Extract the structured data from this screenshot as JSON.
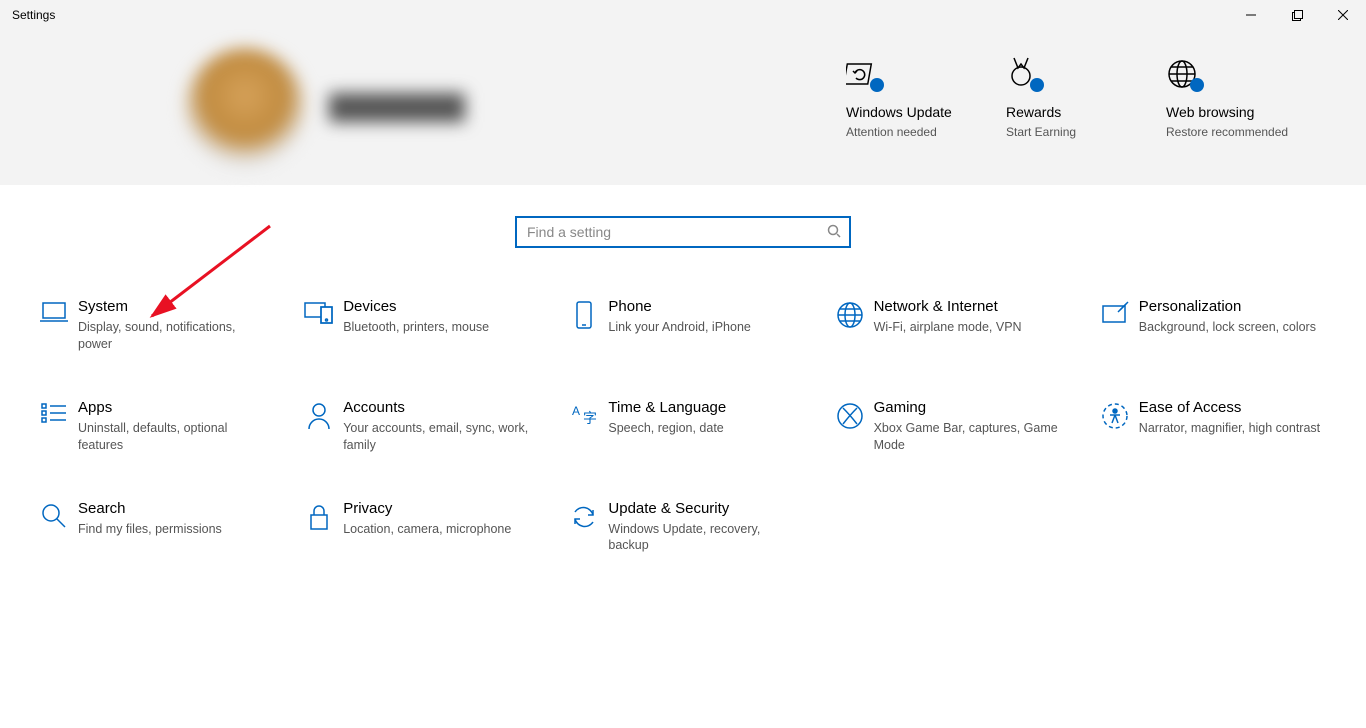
{
  "window": {
    "title": "Settings"
  },
  "search": {
    "placeholder": "Find a setting"
  },
  "header_tiles": [
    {
      "title": "Windows Update",
      "sub": "Attention needed"
    },
    {
      "title": "Rewards",
      "sub": "Start Earning"
    },
    {
      "title": "Web browsing",
      "sub": "Restore recommended"
    }
  ],
  "categories": [
    {
      "title": "System",
      "sub": "Display, sound, notifications, power"
    },
    {
      "title": "Devices",
      "sub": "Bluetooth, printers, mouse"
    },
    {
      "title": "Phone",
      "sub": "Link your Android, iPhone"
    },
    {
      "title": "Network & Internet",
      "sub": "Wi-Fi, airplane mode, VPN"
    },
    {
      "title": "Personalization",
      "sub": "Background, lock screen, colors"
    },
    {
      "title": "Apps",
      "sub": "Uninstall, defaults, optional features"
    },
    {
      "title": "Accounts",
      "sub": "Your accounts, email, sync, work, family"
    },
    {
      "title": "Time & Language",
      "sub": "Speech, region, date"
    },
    {
      "title": "Gaming",
      "sub": "Xbox Game Bar, captures, Game Mode"
    },
    {
      "title": "Ease of Access",
      "sub": "Narrator, magnifier, high contrast"
    },
    {
      "title": "Search",
      "sub": "Find my files, permissions"
    },
    {
      "title": "Privacy",
      "sub": "Location, camera, microphone"
    },
    {
      "title": "Update & Security",
      "sub": "Windows Update, recovery, backup"
    }
  ]
}
